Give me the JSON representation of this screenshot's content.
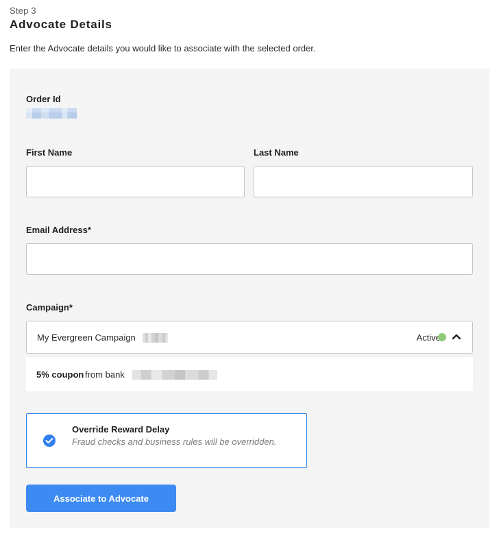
{
  "header": {
    "step_label": "Step 3",
    "title": "Advocate Details",
    "intro": "Enter the Advocate details you would like to associate with the selected order."
  },
  "form": {
    "order_id_label": "Order Id",
    "first_name_label": "First Name",
    "first_name_value": "",
    "last_name_label": "Last Name",
    "last_name_value": "",
    "email_label": "Email Address*",
    "email_value": "",
    "campaign_label": "Campaign*",
    "campaign": {
      "selected": "My Evergreen Campaign",
      "status": "Active",
      "status_color": "#8fc97a",
      "expanded_icon": "chevron-up-icon"
    },
    "reward_option": {
      "bold": "5% coupon",
      "rest": "from bank"
    },
    "override": {
      "title": "Override Reward Delay",
      "description": "Fraud checks and business rules will be overridden.",
      "checked": true,
      "icon": "check-circle-icon"
    },
    "submit_label": "Associate to Advocate"
  },
  "colors": {
    "accent": "#3d8bf2",
    "panel_background": "#f4f4f4",
    "focus_border": "#2f80ed"
  }
}
